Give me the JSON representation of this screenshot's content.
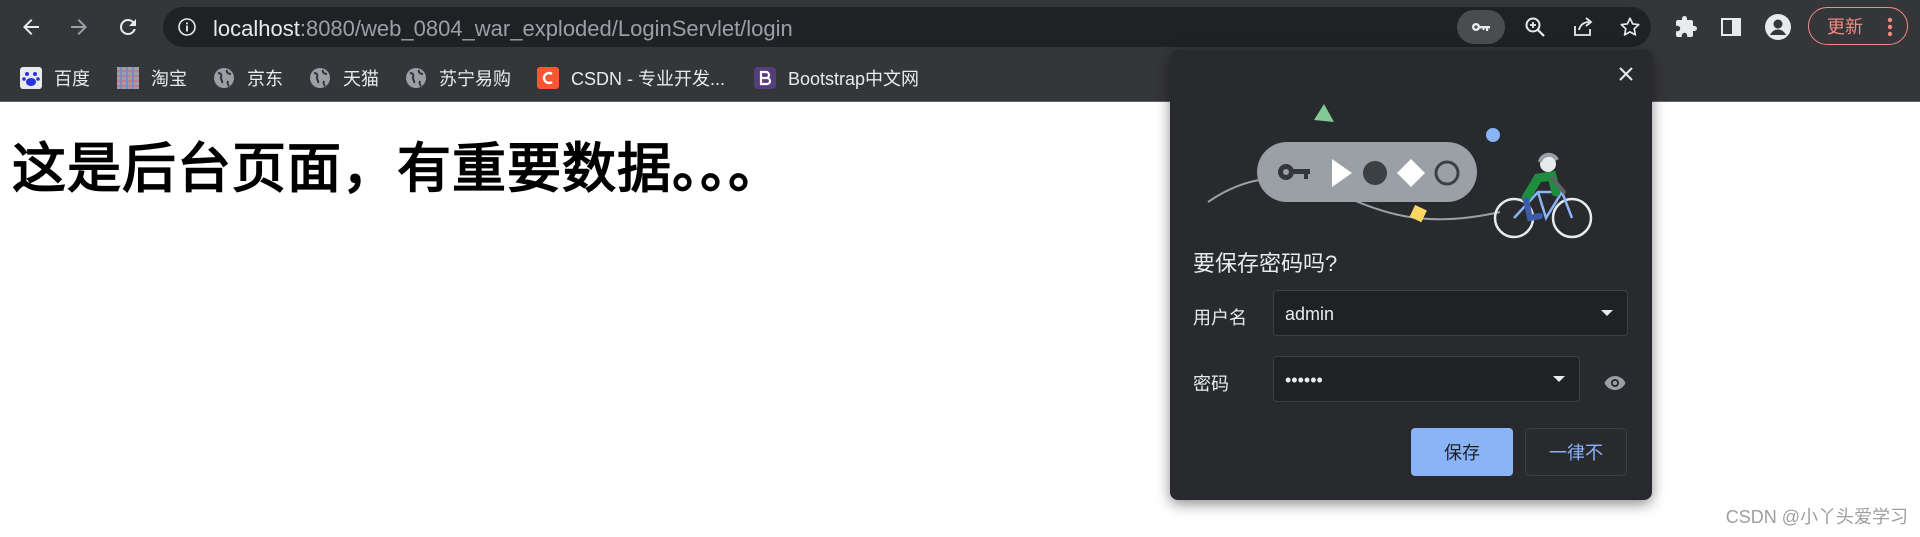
{
  "browser": {
    "url_host": "localhost",
    "url_rest": ":8080/web_0804_war_exploded/LoginServlet/login",
    "update_label": "更新",
    "icons": {
      "back": "back-arrow-icon",
      "forward": "forward-arrow-icon",
      "reload": "reload-icon",
      "info": "info-icon",
      "key": "key-icon",
      "zoom": "zoom-icon",
      "share": "share-icon",
      "star": "star-icon",
      "extensions": "puzzle-icon",
      "side_panel": "side-panel-icon",
      "profile": "profile-icon",
      "menu": "more-vert-icon"
    }
  },
  "bookmarks": [
    {
      "label": "百度",
      "icon": "baidu-icon"
    },
    {
      "label": "淘宝",
      "icon": "taobao-icon"
    },
    {
      "label": "京东",
      "icon": "globe-icon"
    },
    {
      "label": "天猫",
      "icon": "globe-icon"
    },
    {
      "label": "苏宁易购",
      "icon": "globe-icon"
    },
    {
      "label": "CSDN - 专业开发...",
      "icon": "csdn-icon"
    },
    {
      "label": "Bootstrap中文网",
      "icon": "bootstrap-icon"
    }
  ],
  "page": {
    "heading": "这是后台页面，有重要数据。。。",
    "watermark": "CSDN @小丫头爱学习"
  },
  "dialog": {
    "title": "要保存密码吗?",
    "username_label": "用户名",
    "username_value": "admin",
    "password_label": "密码",
    "password_value": "••••••",
    "save_label": "保存",
    "never_label": "一律不"
  },
  "colors": {
    "toolbar_bg": "#35363a",
    "omnibox_bg": "#202124",
    "dialog_bg": "#292a2d",
    "accent_blue": "#8ab4f8",
    "update_red": "#f28b82"
  }
}
